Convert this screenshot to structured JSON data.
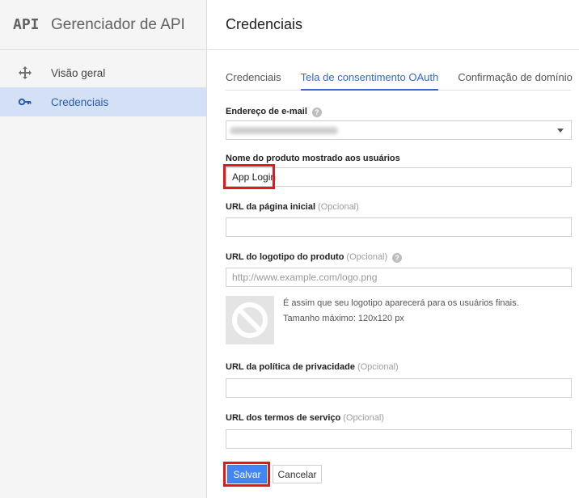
{
  "sidebar": {
    "logo_text": "API",
    "app_name": "Gerenciador de API",
    "items": [
      {
        "label": "Visão geral",
        "icon": "move-icon"
      },
      {
        "label": "Credenciais",
        "icon": "key-icon",
        "active": true
      }
    ]
  },
  "header": {
    "title": "Credenciais"
  },
  "tabs": [
    {
      "label": "Credenciais"
    },
    {
      "label": "Tela de consentimento OAuth",
      "active": true
    },
    {
      "label": "Confirmação de domínio"
    }
  ],
  "form": {
    "email": {
      "label": "Endereço de e-mail",
      "help_icon": "?"
    },
    "product_name": {
      "label": "Nome do produto mostrado aos usuários",
      "value": "App Login"
    },
    "homepage": {
      "label": "URL da página inicial",
      "optional": "(Opcional)",
      "value": ""
    },
    "logo_url": {
      "label": "URL do logotipo do produto",
      "optional": "(Opcional)",
      "help_icon": "?",
      "placeholder": "http://www.example.com/logo.png"
    },
    "logo_note": {
      "line1": "É assim que seu logotipo aparecerá para os usuários finais.",
      "line2": "Tamanho máximo: 120x120 px"
    },
    "privacy": {
      "label": "URL da política de privacidade",
      "optional": "(Opcional)",
      "value": ""
    },
    "terms": {
      "label": "URL dos termos de serviço",
      "optional": "(Opcional)",
      "value": ""
    }
  },
  "actions": {
    "save": "Salvar",
    "cancel": "Cancelar"
  },
  "colors": {
    "accent": "#3367d6",
    "primary_button": "#4285f4",
    "highlight_box": "#e0191f",
    "sidebar_active_bg": "#d3e0f6"
  }
}
